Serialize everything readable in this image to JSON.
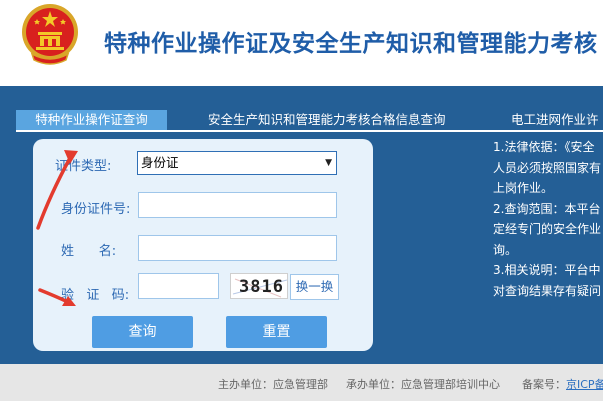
{
  "header": {
    "title": "特种作业操作证及安全生产知识和管理能力考核"
  },
  "tabs": [
    {
      "label": "特种作业操作证查询",
      "active": true
    },
    {
      "label": "安全生产知识和管理能力考核合格信息查询",
      "active": false
    },
    {
      "label": "电工进网作业许",
      "active": false
    }
  ],
  "form": {
    "cert_type_label": "证件类型:",
    "cert_type_value": "身份证",
    "id_label": "身份证件号:",
    "id_value": "",
    "name_label": "姓      名:",
    "name_value": "",
    "captcha_label": "验   证   码:",
    "captcha_value": "",
    "captcha_text": "3816",
    "refresh_label": "换一换",
    "query_button": "查询",
    "reset_button": "重置"
  },
  "info": {
    "lines": [
      "1.法律依据：《安全",
      "人员必须按照国家有",
      "上岗作业。",
      "2.查询范围：本平台",
      "定经专门的安全作业",
      "询。",
      "3.相关说明：平台中",
      "对查询结果存有疑问"
    ]
  },
  "footer": {
    "host": "主办单位：应急管理部",
    "organizer": "承办单位：应急管理部培训中心",
    "icp_label": "备案号：",
    "icp_link": "京ICP备"
  },
  "colors": {
    "main_blue": "#245f96",
    "tab_active": "#5aa5e0",
    "button_blue": "#4f9de3",
    "title_blue": "#1f5da8",
    "arrow_red": "#e33b2e"
  }
}
